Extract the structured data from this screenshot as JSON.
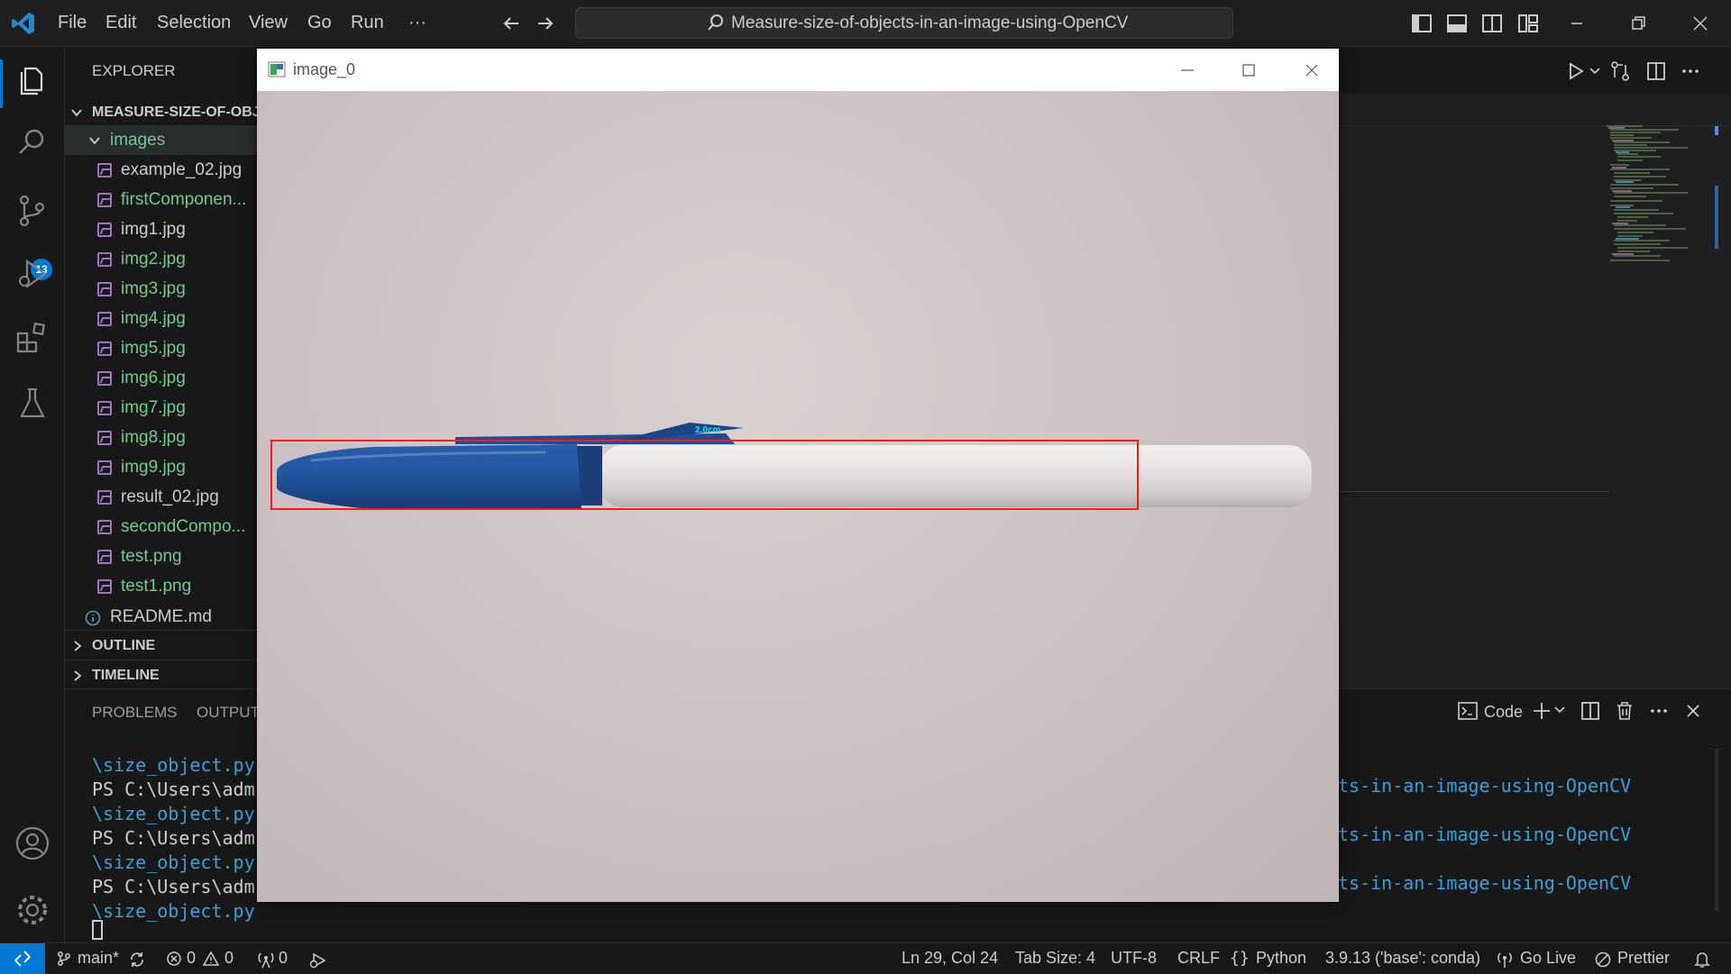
{
  "titlebar": {
    "menus": [
      "File",
      "Edit",
      "Selection",
      "View",
      "Go",
      "Run",
      "···"
    ],
    "search_text": "Measure-size-of-objects-in-an-image-using-OpenCV"
  },
  "activity": {
    "scm_badge": "13"
  },
  "sidebar": {
    "title": "EXPLORER",
    "project": "MEASURE-SIZE-OF-OBJ",
    "folder": "images",
    "files": [
      {
        "name": "example_02.jpg",
        "color": "#cccccc"
      },
      {
        "name": "firstComponen...",
        "color": "#73c991"
      },
      {
        "name": "img1.jpg",
        "color": "#cccccc"
      },
      {
        "name": "img2.jpg",
        "color": "#73c991"
      },
      {
        "name": "img3.jpg",
        "color": "#73c991"
      },
      {
        "name": "img4.jpg",
        "color": "#73c991"
      },
      {
        "name": "img5.jpg",
        "color": "#73c991"
      },
      {
        "name": "img6.jpg",
        "color": "#73c991"
      },
      {
        "name": "img7.jpg",
        "color": "#73c991"
      },
      {
        "name": "img8.jpg",
        "color": "#73c991"
      },
      {
        "name": "img9.jpg",
        "color": "#73c991"
      },
      {
        "name": "result_02.jpg",
        "color": "#cccccc"
      },
      {
        "name": "secondCompo...",
        "color": "#73c991"
      },
      {
        "name": "test.png",
        "color": "#73c991"
      },
      {
        "name": "test1.png",
        "color": "#73c991"
      }
    ],
    "readme": "README.md",
    "outline": "OUTLINE",
    "timeline": "TIMELINE"
  },
  "panel": {
    "tabs": [
      "PROBLEMS",
      "OUTPUT"
    ],
    "terminal_label": "Code",
    "terminal_lines": [
      {
        "text": "\\size_object.py",
        "color": "#3b9fd8"
      },
      {
        "text": "PS C:\\Users\\adm",
        "color": "#cccccc"
      },
      {
        "text": "\\size_object.py",
        "color": "#3b9fd8"
      },
      {
        "text": "PS C:\\Users\\adm",
        "color": "#cccccc"
      },
      {
        "text": "\\size_object.py",
        "color": "#3b9fd8"
      },
      {
        "text": "PS C:\\Users\\adm",
        "color": "#cccccc"
      },
      {
        "text": "\\size_object.py",
        "color": "#3b9fd8"
      }
    ],
    "terminal_right": [
      "ts-in-an-image-using-OpenCV",
      "ts-in-an-image-using-OpenCV",
      "ts-in-an-image-using-OpenCV"
    ]
  },
  "statusbar": {
    "branch": "main*",
    "errors": "0",
    "warnings": "0",
    "ports": "0",
    "position": "Ln 29, Col 24",
    "tab_size": "Tab Size: 4",
    "encoding": "UTF-8",
    "eol": "CRLF",
    "language": "Python",
    "interpreter": "3.9.13 ('base': conda)",
    "go_live": "Go Live",
    "prettier": "Prettier"
  },
  "cv_window": {
    "title": "image_0",
    "measurement_label": "2.0cm",
    "box_color": "#ff1a1a",
    "label_color": "#00e5ff"
  }
}
